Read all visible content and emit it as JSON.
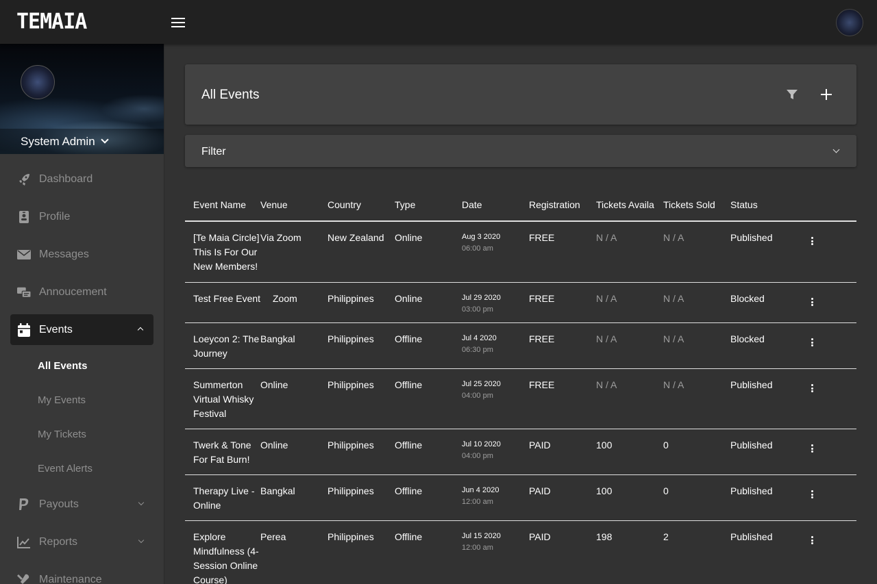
{
  "app": {
    "logo_text": "TEMAIA"
  },
  "user": {
    "name": "System Admin"
  },
  "nav": {
    "items": [
      {
        "label": "Dashboard",
        "icon": "rocket-icon"
      },
      {
        "label": "Profile",
        "icon": "id-badge-icon"
      },
      {
        "label": "Messages",
        "icon": "envelope-icon"
      },
      {
        "label": "Annoucement",
        "icon": "announcement-icon"
      }
    ],
    "events": {
      "label": "Events",
      "icon": "calendar-icon",
      "subitems": [
        {
          "label": "All Events"
        },
        {
          "label": "My Events"
        },
        {
          "label": "My Tickets"
        },
        {
          "label": "Event Alerts"
        }
      ]
    },
    "payouts": {
      "label": "Payouts",
      "icon": "paypal-icon"
    },
    "reports": {
      "label": "Reports",
      "icon": "chart-line-icon"
    },
    "maintenance": {
      "label": "Maintenance",
      "icon": "tools-icon"
    }
  },
  "page": {
    "title": "All Events",
    "filter_label": "Filter"
  },
  "table": {
    "headers": [
      "Event Name",
      "Venue",
      "Country",
      "Type",
      "Date",
      "Registration",
      "Tickets Availa",
      "Tickets Sold",
      "Status"
    ],
    "rows": [
      {
        "name": "[Te Maia Circle] This Is For Our New Members!",
        "venue": "Via Zoom",
        "country": "New Zealand",
        "type": "Online",
        "date": "Aug 3 2020",
        "time": "06:00 am",
        "registration": "FREE",
        "available": "N / A",
        "sold": "N / A",
        "status": "Published"
      },
      {
        "name": "Test Free Event",
        "venue": "Zoom",
        "country": "Philippines",
        "type": "Online",
        "date": "Jul 29 2020",
        "time": "03:00 pm",
        "registration": "FREE",
        "available": "N / A",
        "sold": "N / A",
        "status": "Blocked"
      },
      {
        "name": "Loeycon 2: The Journey",
        "venue": "Bangkal",
        "country": "Philippines",
        "type": "Offline",
        "date": "Jul 4 2020",
        "time": "06:30 pm",
        "registration": "FREE",
        "available": "N / A",
        "sold": "N / A",
        "status": "Blocked"
      },
      {
        "name": "Summerton Virtual Whisky Festival",
        "venue": "Online",
        "country": "Philippines",
        "type": "Offline",
        "date": "Jul 25 2020",
        "time": "04:00 pm",
        "registration": "FREE",
        "available": "N / A",
        "sold": "N / A",
        "status": "Published"
      },
      {
        "name": "Twerk & Tone For Fat Burn!",
        "venue": "Online",
        "country": "Philippines",
        "type": "Offline",
        "date": "Jul 10 2020",
        "time": "04:00 pm",
        "registration": "PAID",
        "available": "100",
        "sold": "0",
        "status": "Published"
      },
      {
        "name": "Therapy Live - Online",
        "venue": "Bangkal",
        "country": "Philippines",
        "type": "Offline",
        "date": "Jun 4 2020",
        "time": "12:00 am",
        "registration": "PAID",
        "available": "100",
        "sold": "0",
        "status": "Published"
      },
      {
        "name": "Explore Mindfulness (4-Session Online Course)",
        "venue": "Perea",
        "country": "Philippines",
        "type": "Offline",
        "date": "Jul 15 2020",
        "time": "12:00 am",
        "registration": "PAID",
        "available": "198",
        "sold": "2",
        "status": "Published"
      }
    ]
  }
}
